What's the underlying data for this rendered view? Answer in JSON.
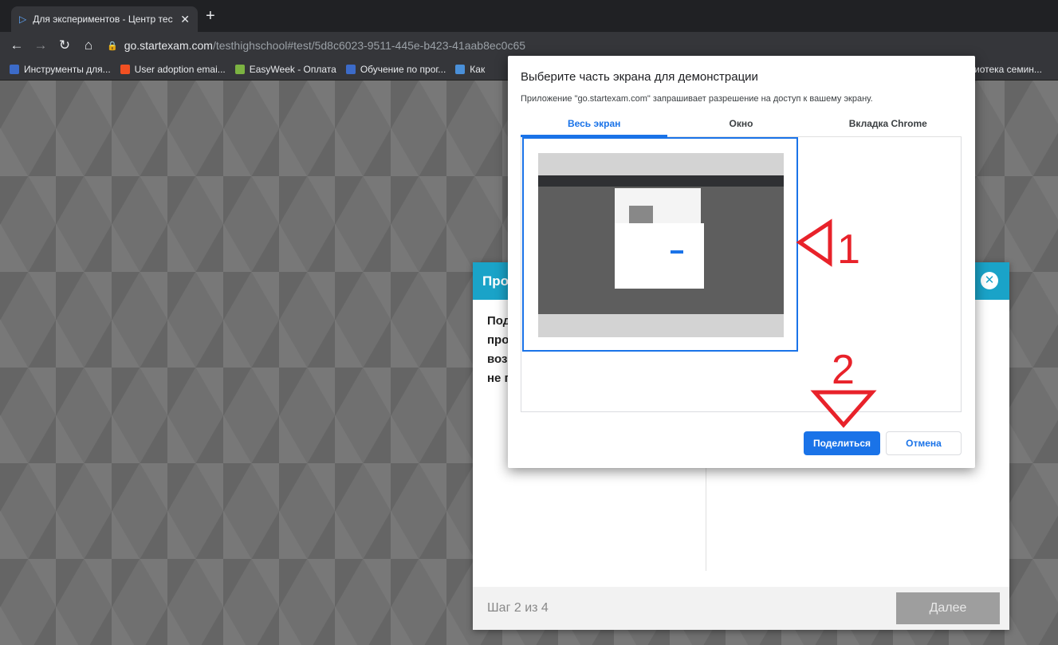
{
  "browser": {
    "tab_title": "Для экспериментов - Центр тес",
    "tab_close": "✕",
    "new_tab": "+",
    "url_host": "go.startexam.com",
    "url_path": "/testhighschool#test/5d8c6023-9511-445e-b423-41aab8ec0c65",
    "bookmarks": [
      {
        "label": "Инструменты для...",
        "icon": "bookmark-b-icon",
        "color": "#3c6bc9"
      },
      {
        "label": "User adoption emai...",
        "icon": "microsoft-icon",
        "color": "#f25022"
      },
      {
        "label": "EasyWeek - Оплата",
        "icon": "easyweek-icon",
        "color": "#7cb342"
      },
      {
        "label": "Обучение по прог...",
        "icon": "bookmark-b-icon",
        "color": "#3c6bc9"
      },
      {
        "label": "Как",
        "icon": "star-icon",
        "color": "#4a90d9"
      }
    ],
    "bookmark_right": "иотека семин..."
  },
  "share_dialog": {
    "title": "Выберите часть экрана для демонстрации",
    "subtitle": "Приложение \"go.startexam.com\" запрашивает разрешение на доступ к вашему экрану.",
    "tabs": [
      "Весь экран",
      "Окно",
      "Вкладка Chrome"
    ],
    "share_label": "Поделиться",
    "cancel_label": "Отмена"
  },
  "wizard": {
    "header": "Про",
    "body_lines": [
      "Под",
      "про",
      "воз",
      "не п"
    ],
    "step": "Шаг 2 из 4",
    "next_label": "Далее"
  },
  "annotations": {
    "label_1": "1",
    "label_2": "2",
    "color": "#e8222a"
  }
}
